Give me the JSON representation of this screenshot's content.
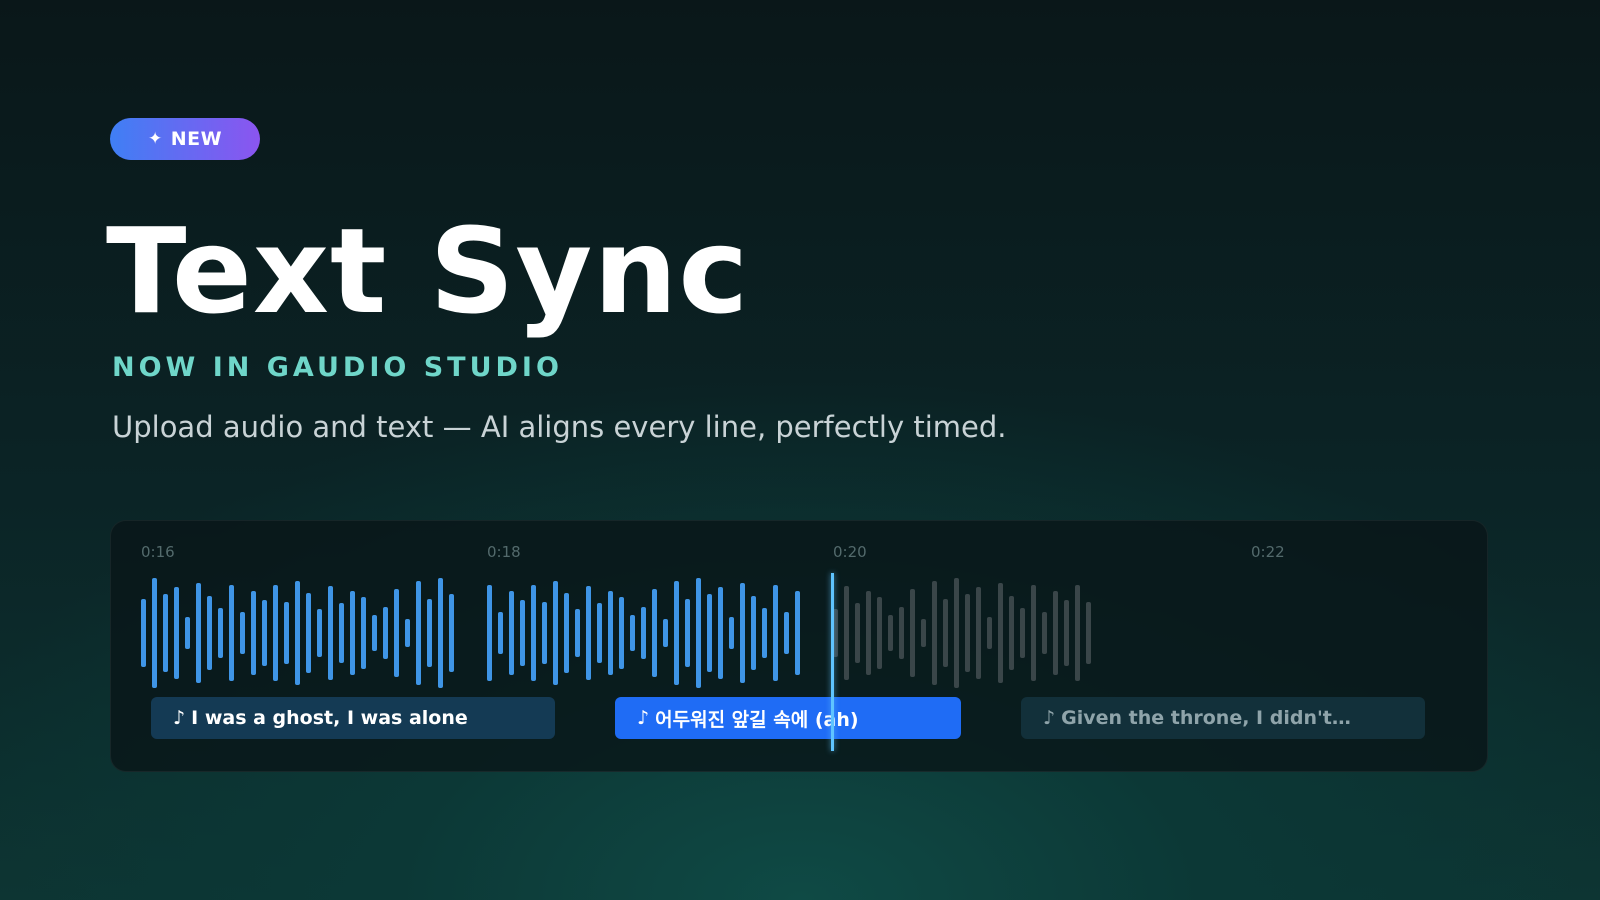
{
  "badge": {
    "icon": "sparkle-icon",
    "text": "✦",
    "label": "NEW"
  },
  "hero": {
    "title": "Text Sync",
    "kicker": "NOW IN GAUDIO STUDIO",
    "subtitle": "Upload audio and text — AI aligns every line, perfectly timed."
  },
  "timeline": {
    "ticks": [
      "0:16",
      "0:18",
      "0:20",
      "0:22"
    ],
    "colors": {
      "played": "#3f95e6",
      "unplayed": "#3a4649",
      "playhead": "#5fc4ff"
    },
    "segments": [
      {
        "note": "♪",
        "text": "I was a ghost, I was alone",
        "state": "done"
      },
      {
        "note": "♪",
        "text": "어두워진 앞길 속에 (ah)",
        "state": "active"
      },
      {
        "note": "♪",
        "text": "Given the throne, I didn't…",
        "state": "upcoming"
      }
    ]
  }
}
